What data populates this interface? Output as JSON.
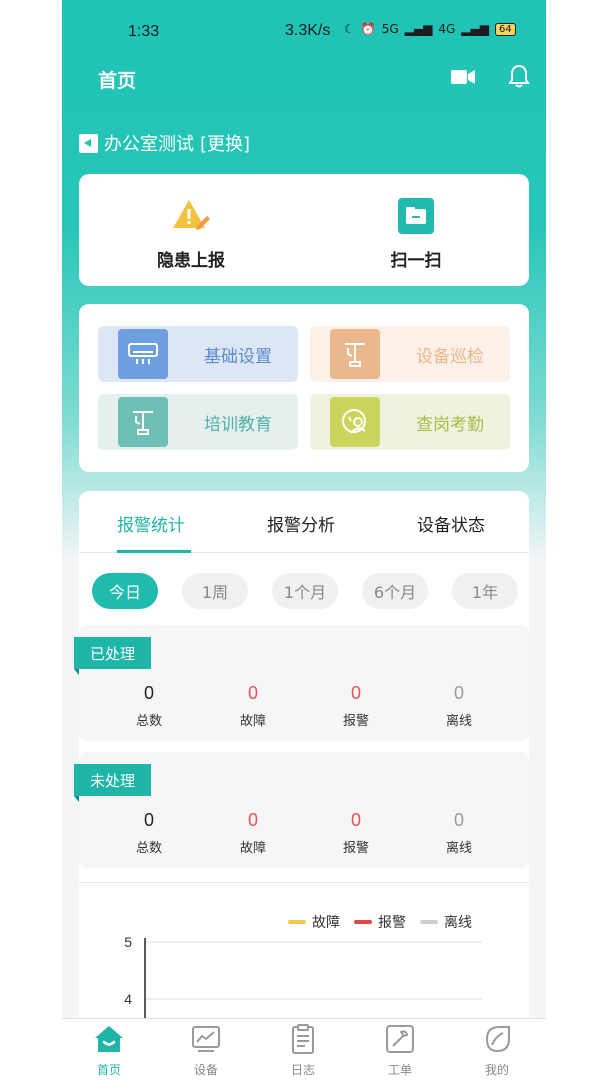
{
  "status_bar": {
    "time": "1:33",
    "network_speed": "3.3K/s",
    "signal_1": "5G",
    "signal_2": "4G",
    "battery": "64"
  },
  "header": {
    "title": "首页"
  },
  "unit": {
    "name": "办公室测试",
    "change_label": "[更换]"
  },
  "quick_actions": [
    {
      "label": "隐患上报",
      "icon": "warning-edit-icon"
    },
    {
      "label": "扫一扫",
      "icon": "scan-icon"
    }
  ],
  "menu_tiles": [
    {
      "label": "基础设置",
      "icon": "air-conditioner-icon",
      "bg": "#dce6f5",
      "icon_bg": "#6e9fe0",
      "text_color": "#5b8bd1"
    },
    {
      "label": "设备巡检",
      "icon": "inspection-icon",
      "bg": "#fdf0e9",
      "icon_bg": "#ebb88e",
      "text_color": "#e9b688"
    },
    {
      "label": "培训教育",
      "icon": "lamp-icon",
      "bg": "#e4efee",
      "icon_bg": "#6ebfb6",
      "text_color": "#4fb0a6"
    },
    {
      "label": "查岗考勤",
      "icon": "person-clock-icon",
      "bg": "#eef3df",
      "icon_bg": "#cbd45b",
      "text_color": "#a9bd47"
    }
  ],
  "tabs": [
    {
      "label": "报警统计",
      "active": true
    },
    {
      "label": "报警分析",
      "active": false
    },
    {
      "label": "设备状态",
      "active": false
    }
  ],
  "ranges": [
    {
      "label": "今日",
      "active": true
    },
    {
      "label": "1周",
      "active": false
    },
    {
      "label": "1个月",
      "active": false
    },
    {
      "label": "6个月",
      "active": false
    },
    {
      "label": "1年",
      "active": false
    }
  ],
  "processed": {
    "title": "已处理",
    "stats": [
      {
        "value": "0",
        "label": "总数",
        "color": "#222222"
      },
      {
        "value": "0",
        "label": "故障",
        "color": "#e45454"
      },
      {
        "value": "0",
        "label": "报警",
        "color": "#e45454"
      },
      {
        "value": "0",
        "label": "离线",
        "color": "#999999"
      }
    ]
  },
  "unprocessed": {
    "title": "未处理",
    "stats": [
      {
        "value": "0",
        "label": "总数",
        "color": "#222222"
      },
      {
        "value": "0",
        "label": "故障",
        "color": "#e45454"
      },
      {
        "value": "0",
        "label": "报警",
        "color": "#e45454"
      },
      {
        "value": "0",
        "label": "离线",
        "color": "#999999"
      }
    ]
  },
  "chart_data": {
    "type": "line",
    "series": [
      {
        "name": "故障",
        "color": "#f2c94c",
        "values": []
      },
      {
        "name": "报警",
        "color": "#e04848",
        "values": []
      },
      {
        "name": "离线",
        "color": "#cfcfcf",
        "values": []
      }
    ],
    "y_ticks": [
      "5",
      "4"
    ],
    "grid": true,
    "legend_position": "top-right"
  },
  "nav": [
    {
      "label": "首页",
      "icon": "home-icon",
      "active": true
    },
    {
      "label": "设备",
      "icon": "device-chart-icon",
      "active": false
    },
    {
      "label": "日志",
      "icon": "log-icon",
      "active": false
    },
    {
      "label": "工单",
      "icon": "work-order-icon",
      "active": false
    },
    {
      "label": "我的",
      "icon": "profile-leaf-icon",
      "active": false
    }
  ],
  "colors": {
    "accent": "#1fb5a8",
    "header_gradient_top": "#1fc3b5"
  }
}
